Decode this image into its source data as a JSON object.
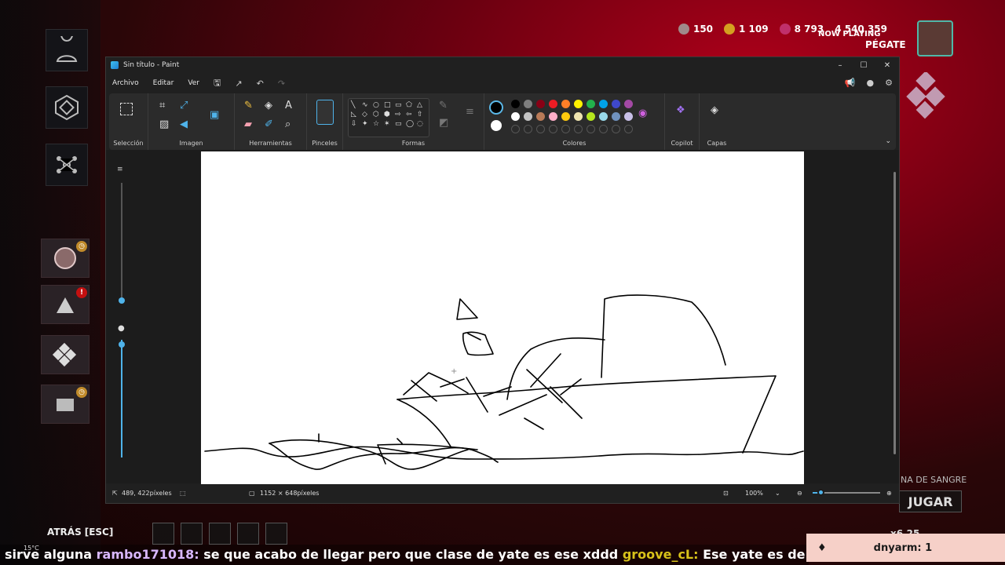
{
  "paint": {
    "title": "Sin título - Paint",
    "menu": {
      "file": "Archivo",
      "edit": "Editar",
      "view": "Ver"
    },
    "ribbon": {
      "selection": "Selección",
      "image": "Imagen",
      "tools": "Herramientas",
      "brushes": "Pinceles",
      "shapes": "Formas",
      "colors": "Colores",
      "copilot": "Copilot",
      "layers": "Capas"
    },
    "palette": [
      "#000000",
      "#7f7f7f",
      "#880015",
      "#ed1c24",
      "#ff7f27",
      "#fff200",
      "#22b14c",
      "#00a2e8",
      "#3f48cc",
      "#a349a4",
      "#ffffff",
      "#c3c3c3",
      "#b97a57",
      "#ffaec9",
      "#ffc90e",
      "#efe4b0",
      "#b5e61d",
      "#99d9ea",
      "#7092be",
      "#c8bfe7"
    ],
    "status": {
      "cursor": "489, 422píxeles",
      "size": "1152 × 648píxeles",
      "zoom": "100%"
    },
    "zoom_fraction": 0.12
  },
  "game": {
    "currency": [
      "150",
      "1 109",
      "8 793",
      "4 540 359"
    ],
    "now_playing": "NOW PLAYING",
    "song": "PÉGATE",
    "sangre": "NA DE SANGRE",
    "jugar": "JUGAR",
    "price": "x6.25",
    "atras": "ATRÁS",
    "esc": "[ESC]",
    "weather": "15°C"
  },
  "chat": {
    "line_prefix": "sirve alguna ",
    "user1": "rambo171018:",
    "msg1": " se que acabo de llegar pero que clase de yate es ese xddd ",
    "user2": "groove_cL:",
    "msg2": " Ese yate es de sangre ?"
  },
  "gift": {
    "user": "dnyarm:",
    "count": "1"
  }
}
